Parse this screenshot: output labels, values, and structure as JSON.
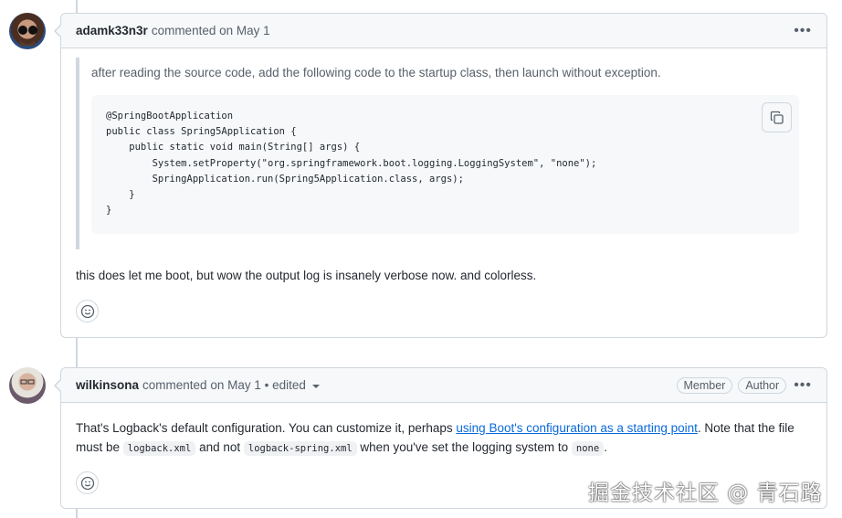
{
  "comments": [
    {
      "user": "adamk33n3r",
      "meta": "commented on May 1",
      "quote": "after reading the source code, add the following code to the startup class, then launch without exception.",
      "code": "@SpringBootApplication\npublic class Spring5Application {\n    public static void main(String[] args) {\n        System.setProperty(\"org.springframework.boot.logging.LoggingSystem\", \"none\");\n        SpringApplication.run(Spring5Application.class, args);\n    }\n}",
      "body": "this does let me boot, but wow the output log is insanely verbose now. and colorless."
    },
    {
      "user": "wilkinsona",
      "meta": "commented on May 1 • edited",
      "badges": [
        "Member",
        "Author"
      ],
      "body_pre": "That's Logback's default configuration. You can customize it, perhaps ",
      "link": "using Boot's configuration as a starting point",
      "body_mid": ". Note that the file must be ",
      "code1": "logback.xml",
      "body_and": " and not ",
      "code2": "logback-spring.xml",
      "body_when": " when you've set the logging system to ",
      "code3": "none",
      "body_end": "."
    }
  ],
  "more_label": "•••",
  "watermark": "掘金技术社区 @ 青石路"
}
